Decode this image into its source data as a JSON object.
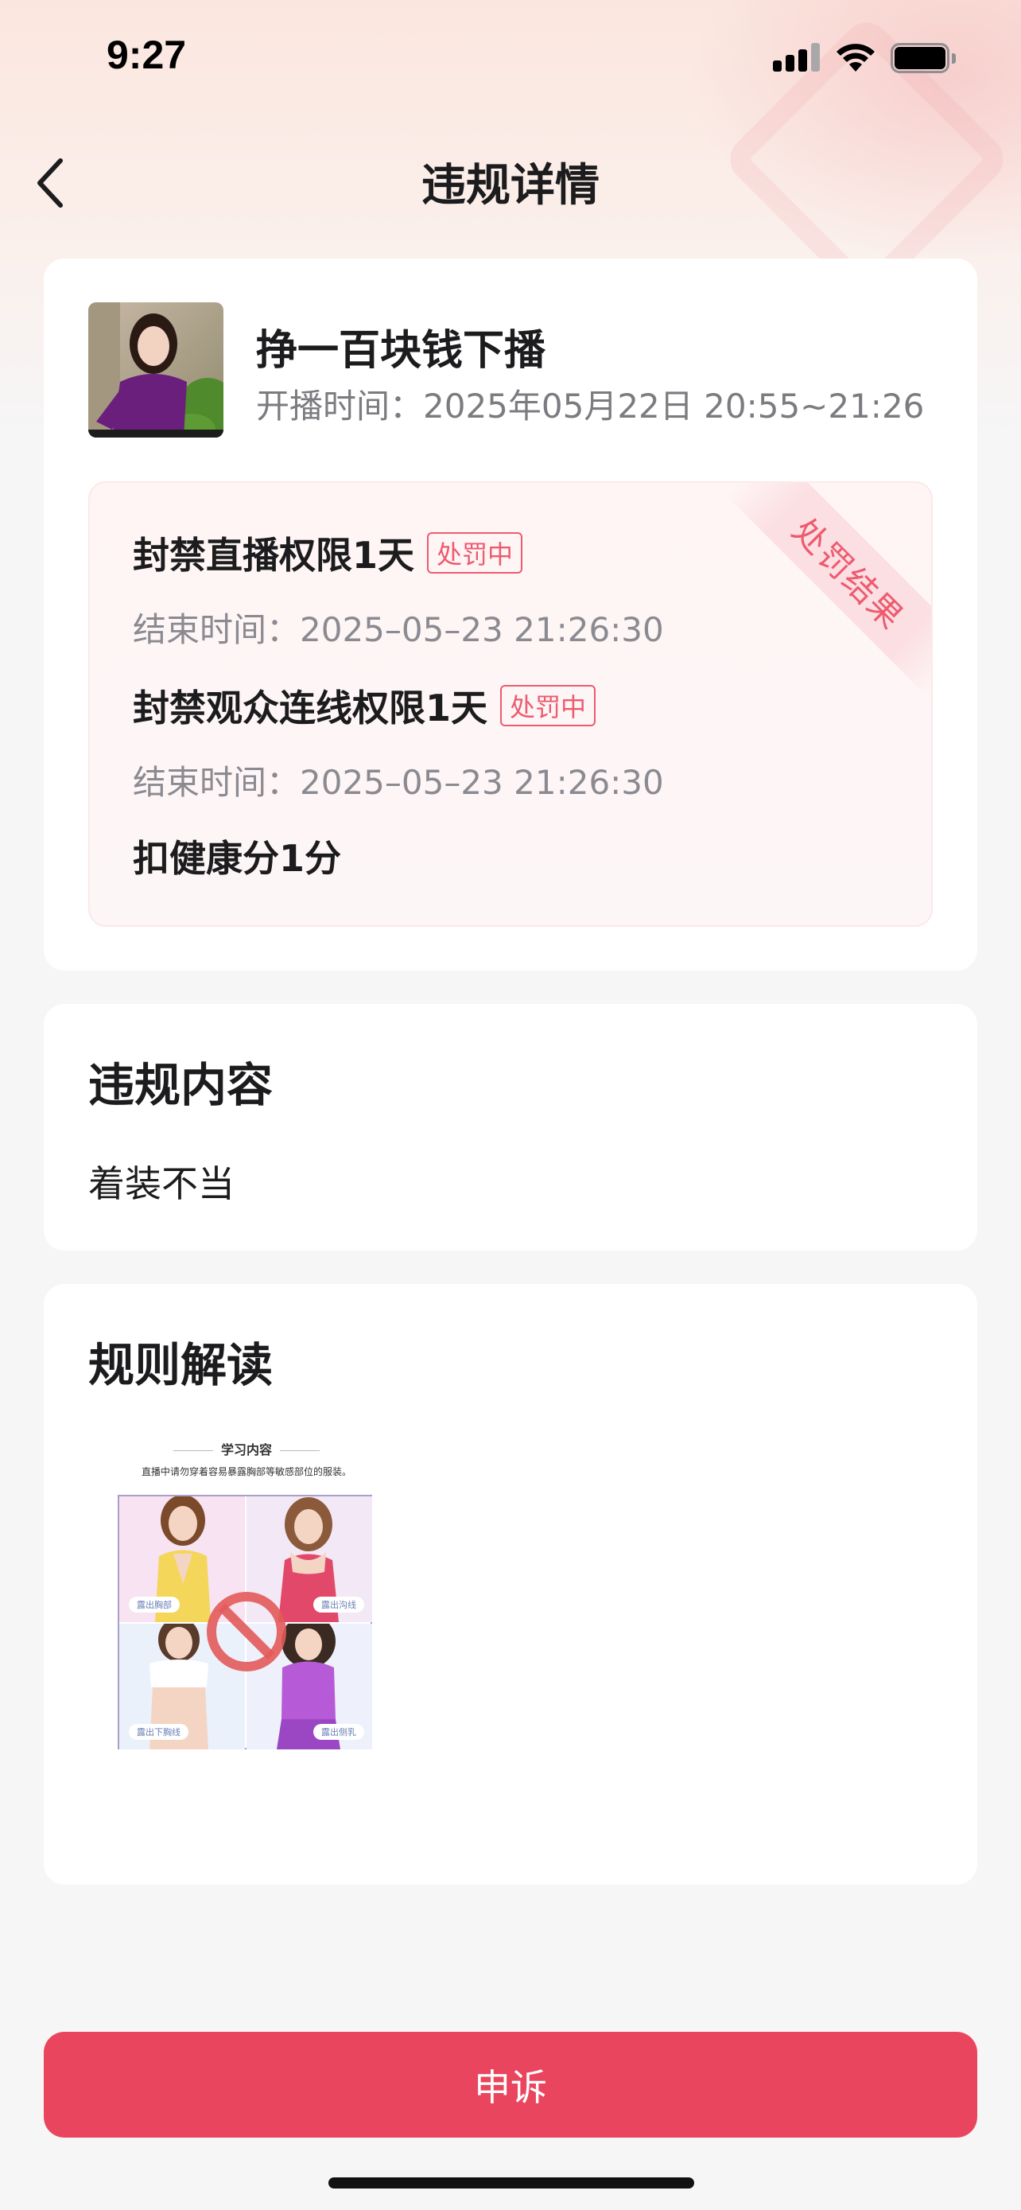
{
  "status_bar": {
    "time": "9:27"
  },
  "nav": {
    "title": "违规详情"
  },
  "stream": {
    "title": "挣一百块钱下播",
    "time_label": "开播时间：2025年05月22日 20:55~21:26"
  },
  "penalty": {
    "ribbon": "处罚结果",
    "items": [
      {
        "title": "封禁直播权限1天",
        "tag": "处罚中",
        "end": "结束时间：2025–05–23 21:26:30"
      },
      {
        "title": "封禁观众连线权限1天",
        "tag": "处罚中",
        "end": "结束时间：2025–05–23 21:26:30"
      },
      {
        "title": "扣健康分1分"
      }
    ]
  },
  "violation": {
    "title": "违规内容",
    "content": "着装不当"
  },
  "rules": {
    "title": "规则解读",
    "image_header": "学习内容",
    "image_sub": "直播中请勿穿着容易暴露胸部等敏感部位的服装。",
    "labels": [
      "露出胸部",
      "露出沟线",
      "露出下胸线",
      "露出侧乳"
    ]
  },
  "appeal": {
    "label": "申诉"
  },
  "colors": {
    "accent": "#ea455e",
    "tag": "#ee5a6e",
    "background": "#f6f6f7"
  }
}
